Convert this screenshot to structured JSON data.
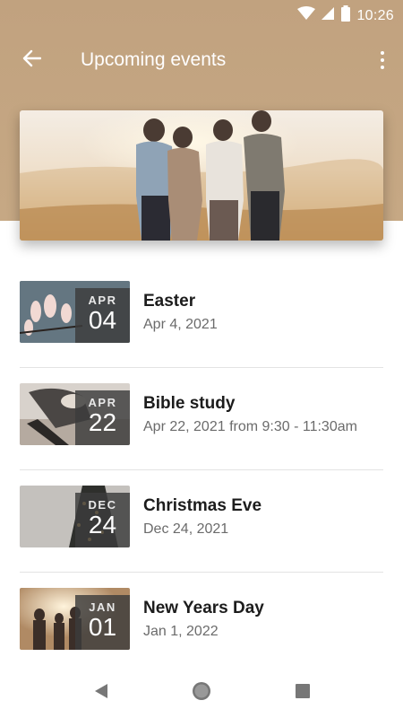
{
  "status_bar": {
    "time": "10:26",
    "icons": [
      "wifi-icon",
      "signal-icon",
      "battery-icon"
    ]
  },
  "toolbar": {
    "back_icon": "arrow-left-icon",
    "title": "Upcoming events",
    "more_icon": "more-vertical-icon"
  },
  "colors": {
    "header_bg": "#c1a27f",
    "title_text": "#ffffff",
    "event_title": "#1c1c1c",
    "event_subtitle": "#6b6b6b",
    "date_box": "#3c3c3c"
  },
  "events": [
    {
      "month": "APR",
      "day": "04",
      "title": "Easter",
      "subtitle": "Apr 4, 2021"
    },
    {
      "month": "APR",
      "day": "22",
      "title": "Bible study",
      "subtitle": "Apr 22, 2021 from 9:30 - 11:30am"
    },
    {
      "month": "DEC",
      "day": "24",
      "title": "Christmas Eve",
      "subtitle": "Dec 24, 2021"
    },
    {
      "month": "JAN",
      "day": "01",
      "title": "New Years Day",
      "subtitle": "Jan 1, 2022"
    }
  ],
  "nav_bar": {
    "icons": [
      "back-triangle-icon",
      "home-circle-icon",
      "recents-square-icon"
    ]
  }
}
